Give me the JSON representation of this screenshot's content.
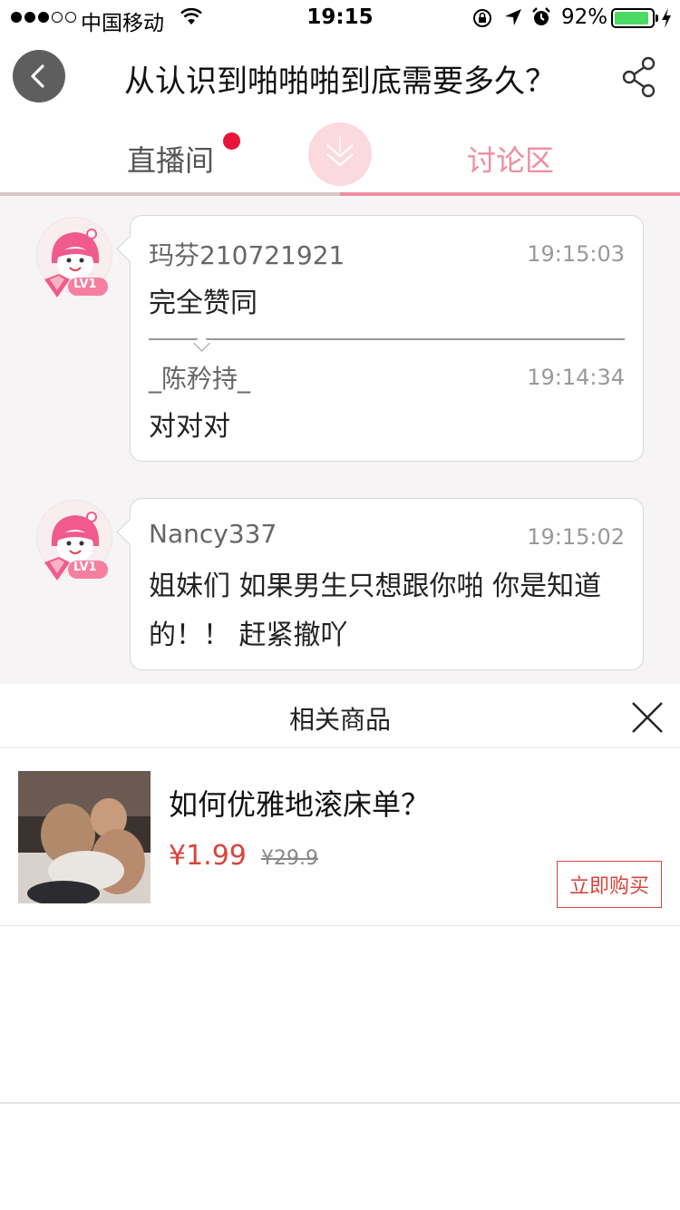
{
  "status_bar": {
    "carrier": "中国移动",
    "time": "19:15",
    "battery_percent": "92%",
    "signal_bars_filled": 3,
    "signal_bars_total": 5,
    "battery_level": 0.92,
    "battery_color": "#4cd964"
  },
  "nav": {
    "title": "从认识到啪啪啪到底需要多久？",
    "back_icon": "chevron-left-icon",
    "share_icon": "share-icon"
  },
  "tabs": {
    "live_label": "直播间",
    "discuss_label": "讨论区",
    "active": "讨论区",
    "active_color": "#f28ca0",
    "badge_color": "#e8143c",
    "center_icon": "double-chevron-down-icon"
  },
  "messages": [
    {
      "user": "玛芬210721921",
      "time": "19:15:03",
      "text": "完全赞同",
      "avatar_badge": "LV1",
      "reply": {
        "user": "_陈矜持_",
        "time": "19:14:34",
        "text": "对对对"
      }
    },
    {
      "user": "Nancy337",
      "time": "19:15:02",
      "text": "姐妹们 如果男生只想跟你啪 你是知道的！！ 赶紧撤吖",
      "avatar_badge": "LV1"
    }
  ],
  "related": {
    "title": "相关商品",
    "close_icon": "close-icon",
    "product": {
      "title": "如何优雅地滚床单？",
      "price": "¥1.99",
      "old_price": "¥29.9",
      "buy_label": "立即购买",
      "price_color": "#d9443c"
    }
  }
}
